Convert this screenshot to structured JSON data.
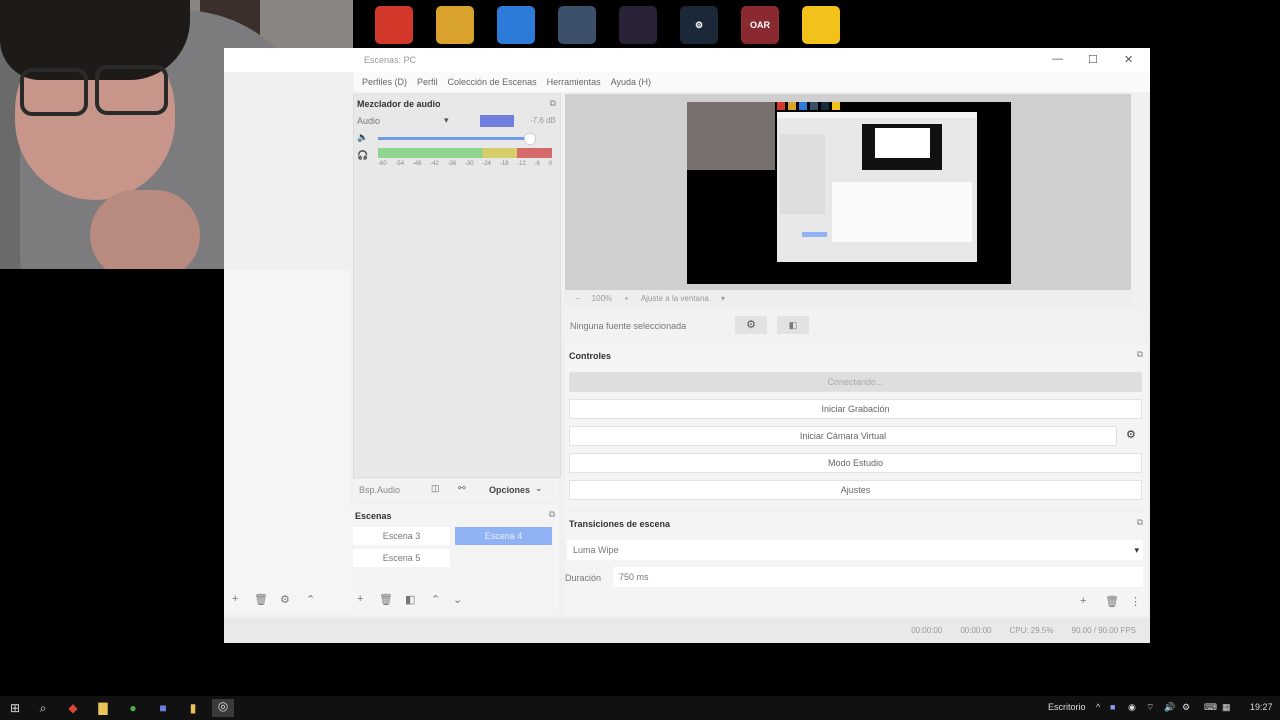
{
  "desktop": {
    "icons": [
      {
        "name": "game-icon-1",
        "color": "#d2382a",
        "label": ""
      },
      {
        "name": "game-icon-2",
        "color": "#d8a22c",
        "label": ""
      },
      {
        "name": "game-icon-3",
        "color": "#2c7bd8",
        "label": ""
      },
      {
        "name": "game-icon-4",
        "color": "#3c4f6b",
        "label": ""
      },
      {
        "name": "game-icon-5",
        "color": "#2a2236",
        "label": ""
      },
      {
        "name": "steam-icon",
        "color": "#1b2838",
        "label": "⚙"
      },
      {
        "name": "game-icon-7",
        "color": "#8a2a30",
        "label": "OAR"
      },
      {
        "name": "game-icon-8",
        "color": "#f2c21b",
        "label": ""
      }
    ]
  },
  "window": {
    "title": "Escenas: PC",
    "menu": [
      "Perfiles (D)",
      "Perfil",
      "Colección de Escenas",
      "Herramientas",
      "Ayuda (H)"
    ]
  },
  "mixer": {
    "title": "Mezclador de audio",
    "source": "Audio",
    "db": "-7.6 dB",
    "scale": [
      "-60",
      "-54",
      "-48",
      "-42",
      "-36",
      "-30",
      "-24",
      "-18",
      "-12",
      "-6",
      "0"
    ]
  },
  "preview": {
    "zoom": "100%",
    "fit": "Ajuste a la ventana"
  },
  "sources": {
    "none_selected": "Ninguna fuente seleccionada"
  },
  "controls": {
    "title": "Controles",
    "buttons": [
      "Conectando...",
      "Iniciar Grabación",
      "Iniciar Cámara Virtual",
      "Modo Estudio",
      "Ajustes"
    ]
  },
  "mixer_footer": {
    "label": "Bsp.Audio",
    "options": "Opciones"
  },
  "scenes": {
    "title": "Escenas",
    "items": [
      {
        "label": "Escena 3",
        "selected": false
      },
      {
        "label": "Escena 4",
        "selected": true
      },
      {
        "label": "Escena 5",
        "selected": false
      }
    ]
  },
  "transitions": {
    "title": "Transiciones de escena",
    "selected": "Luma Wipe",
    "duration_label": "Duración",
    "duration_value": "750 ms"
  },
  "status": {
    "live_time": "00:00:00",
    "rec_time": "00:00:00",
    "cpu": "CPU: 29.5%",
    "fps": "90.00 / 90.00 FPS"
  },
  "taskbar": {
    "desktop_label": "Escritorio",
    "clock": "19:27"
  }
}
